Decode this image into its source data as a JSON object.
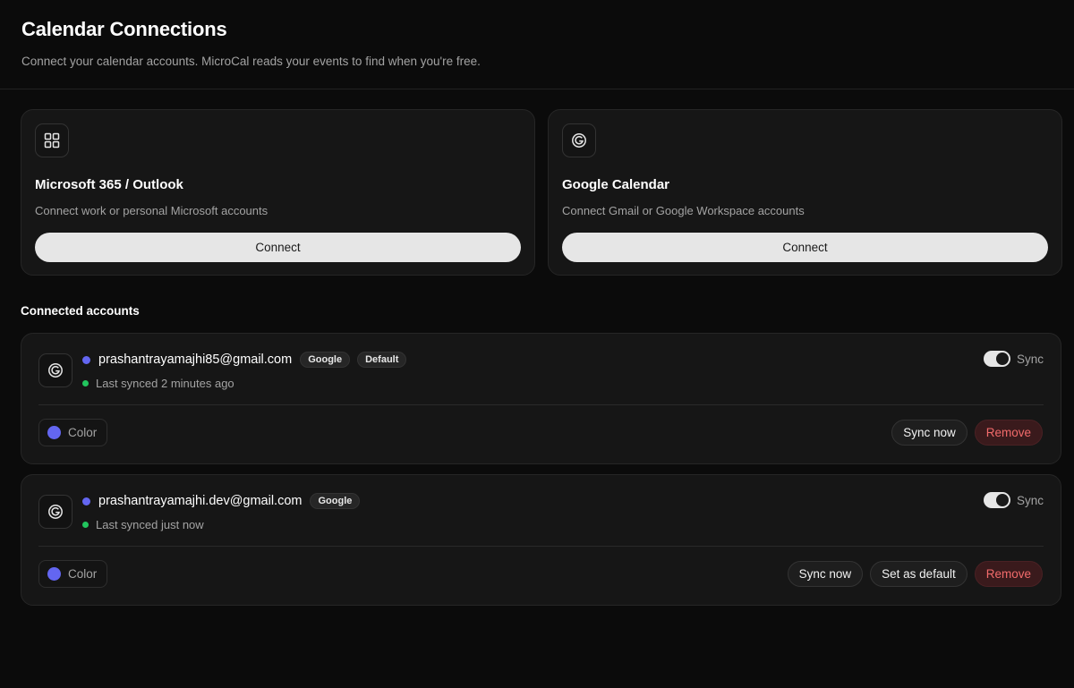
{
  "header": {
    "title": "Calendar Connections",
    "subtitle": "Connect your calendar accounts. MicroCal reads your events to find when you're free."
  },
  "providers": [
    {
      "name": "Microsoft 365 / Outlook",
      "description": "Connect work or personal Microsoft accounts",
      "button": "Connect",
      "icon": "grid-icon"
    },
    {
      "name": "Google Calendar",
      "description": "Connect Gmail or Google Workspace accounts",
      "button": "Connect",
      "icon": "google-icon"
    }
  ],
  "connected": {
    "title": "Connected accounts",
    "accounts": [
      {
        "email": "prashantrayamajhi85@gmail.com",
        "provider_badge": "Google",
        "default_badge": "Default",
        "status": "Last synced 2 minutes ago",
        "sync_label": "Sync",
        "sync_on": true,
        "color_label": "Color",
        "color": "#6366f1",
        "actions": {
          "sync_now": "Sync now",
          "remove": "Remove"
        }
      },
      {
        "email": "prashantrayamajhi.dev@gmail.com",
        "provider_badge": "Google",
        "status": "Last synced just now",
        "sync_label": "Sync",
        "sync_on": true,
        "color_label": "Color",
        "color": "#6366f1",
        "actions": {
          "sync_now": "Sync now",
          "set_default": "Set as default",
          "remove": "Remove"
        }
      }
    ]
  },
  "colors": {
    "accent": "#6366f1",
    "status_ok": "#22c55e",
    "danger": "#f26b6b"
  }
}
